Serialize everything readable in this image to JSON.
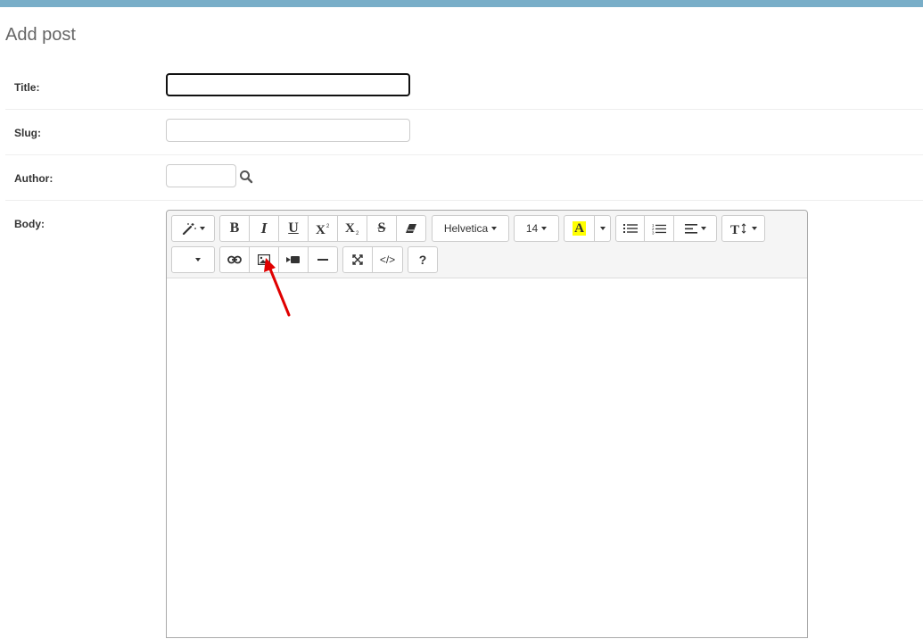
{
  "page": {
    "title": "Add post"
  },
  "form": {
    "title_label": "Title:",
    "slug_label": "Slug:",
    "author_label": "Author:",
    "body_label": "Body:",
    "title_value": "",
    "slug_value": "",
    "author_value": ""
  },
  "editor": {
    "font_family": "Helvetica",
    "font_size": "14",
    "toolbar_row1": [
      "style-magic",
      "bold",
      "italic",
      "underline",
      "superscript",
      "subscript",
      "strikethrough",
      "clear-format",
      "font-family",
      "font-size",
      "color",
      "unordered-list",
      "ordered-list",
      "paragraph-align",
      "line-height"
    ],
    "toolbar_row2": [
      "table",
      "link",
      "picture",
      "video",
      "horizontal-rule",
      "fullscreen",
      "code-view",
      "help"
    ],
    "help_label": "?",
    "code_label": "</>",
    "bold_label": "B",
    "italic_label": "I",
    "underline_label": "U",
    "strike_label": "S",
    "color_label": "A",
    "content": ""
  },
  "colors": {
    "topbar": "#79aec8",
    "annotation_arrow": "#e00000",
    "highlight": "#ffff00"
  }
}
